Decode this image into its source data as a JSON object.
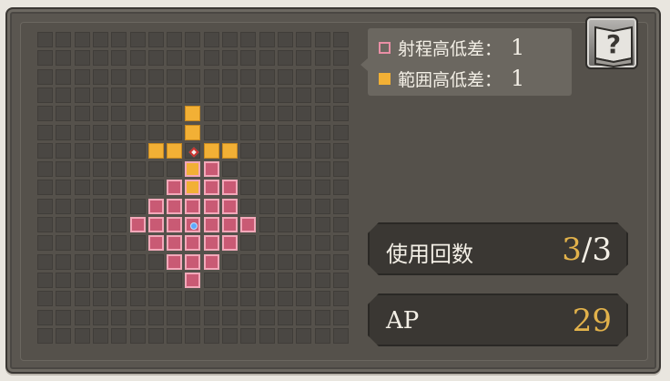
{
  "legend": {
    "shooting_label": "射程高低差：",
    "shooting_value": "1",
    "area_label": "範囲高低差：",
    "area_value": "1",
    "colors": {
      "range": "#c95a74",
      "area": "#f2b035"
    }
  },
  "help": {
    "icon": "question-book-icon",
    "symbol": "?"
  },
  "usage": {
    "label": "使用回数",
    "current": "3",
    "separator": "/",
    "max": "3"
  },
  "ap": {
    "label": "AP",
    "value": "29"
  },
  "grid": {
    "columns": 17,
    "rows": 17,
    "range_rows": [
      [
        7,
        [
          8,
          9
        ]
      ],
      [
        8,
        [
          7,
          8,
          9,
          10
        ]
      ],
      [
        9,
        [
          6,
          7,
          8,
          9,
          10
        ]
      ],
      [
        10,
        [
          5,
          6,
          7,
          8,
          9,
          10,
          11
        ]
      ],
      [
        11,
        [
          6,
          7,
          8,
          9,
          10
        ]
      ],
      [
        12,
        [
          7,
          8,
          9
        ]
      ],
      [
        13,
        [
          8
        ]
      ]
    ],
    "area_cells": [
      [
        4,
        8
      ],
      [
        5,
        8
      ],
      [
        6,
        6
      ],
      [
        6,
        7
      ],
      [
        6,
        9
      ],
      [
        6,
        10
      ],
      [
        7,
        8
      ],
      [
        8,
        8
      ]
    ],
    "target_marker": [
      6,
      8
    ],
    "caster_marker": [
      10,
      8
    ]
  }
}
